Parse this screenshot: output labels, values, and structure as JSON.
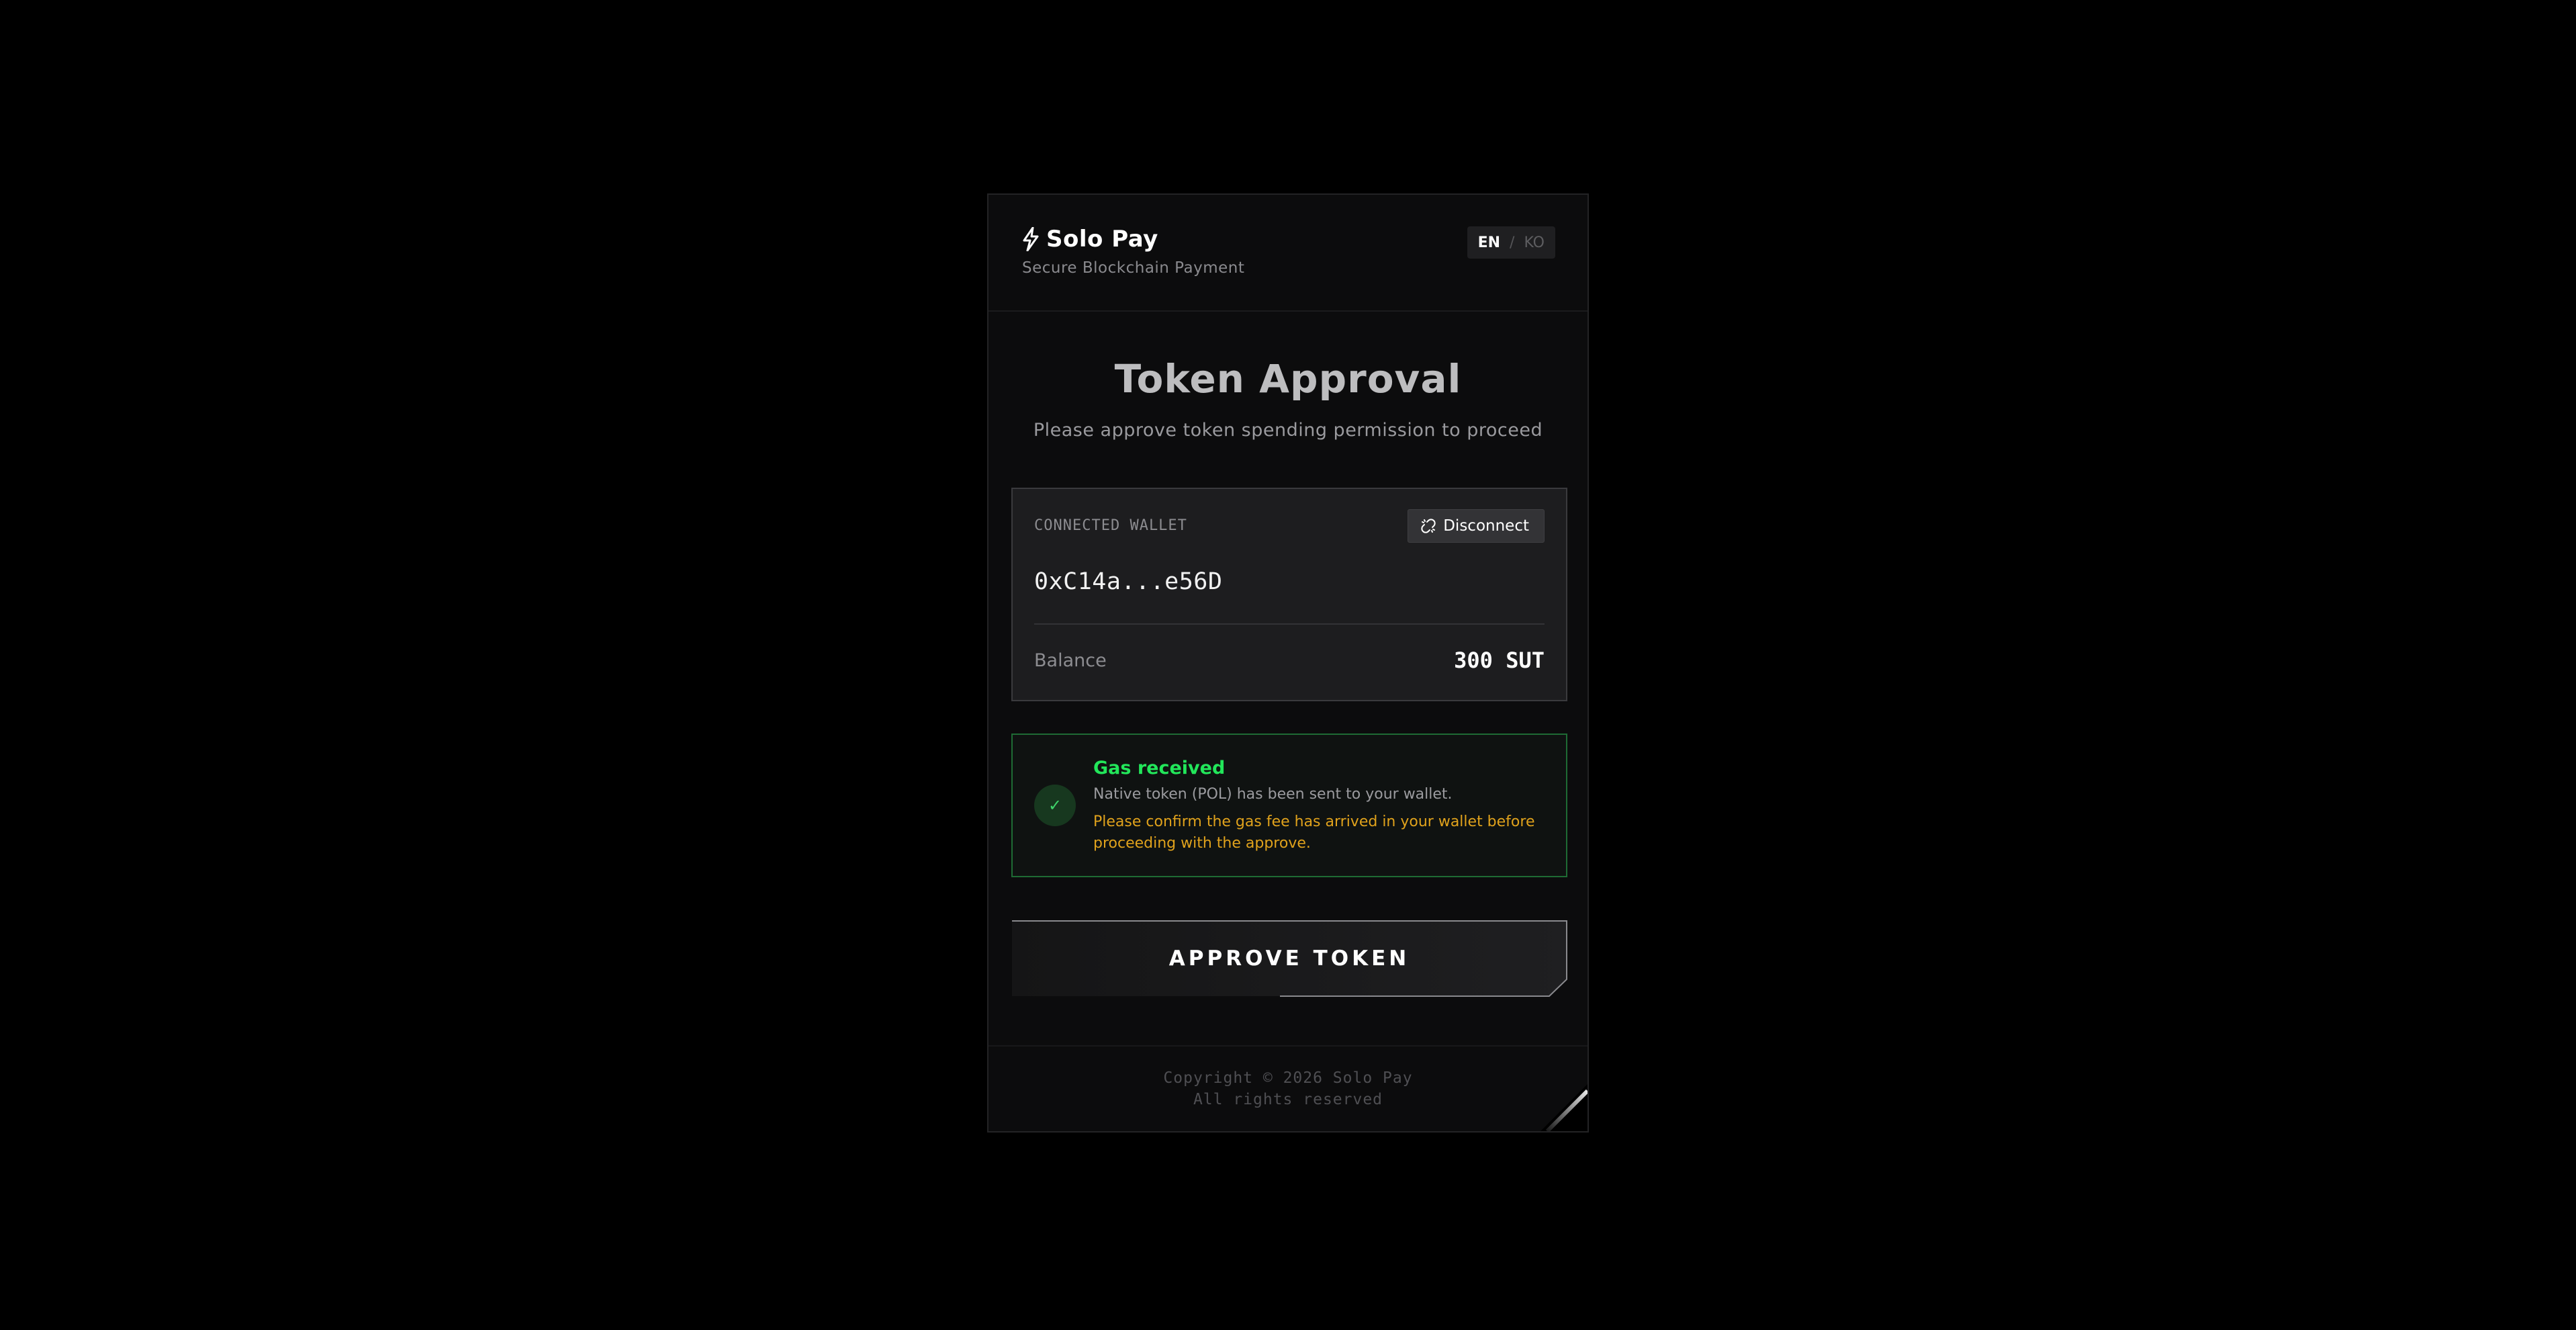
{
  "header": {
    "brand_icon": "bolt-icon",
    "brand_name": "Solo Pay",
    "tagline": "Secure Blockchain Payment",
    "lang": {
      "active": "EN",
      "separator": "/",
      "inactive": "KO"
    }
  },
  "main": {
    "title": "Token Approval",
    "subtitle": "Please approve token spending permission to proceed"
  },
  "wallet": {
    "label": "CONNECTED WALLET",
    "disconnect_icon": "unlink-icon",
    "disconnect_label": "Disconnect",
    "address": "0xC14a...e56D",
    "balance_label": "Balance",
    "balance_value": "300 SUT"
  },
  "notice": {
    "icon": "check-icon",
    "icon_glyph": "✓",
    "title": "Gas received",
    "body": "Native token (POL) has been sent to your wallet.",
    "warning": "Please confirm the gas fee has arrived in your wallet before proceeding with the approve."
  },
  "action": {
    "approve_label": "APPROVE TOKEN"
  },
  "footer": {
    "copyright": "Copyright © 2026 Solo Pay",
    "rights": "All rights reserved"
  },
  "colors": {
    "background": "#000000",
    "card": "#0c0c0d",
    "success": "#22e65a",
    "warning": "#e0a21c"
  }
}
